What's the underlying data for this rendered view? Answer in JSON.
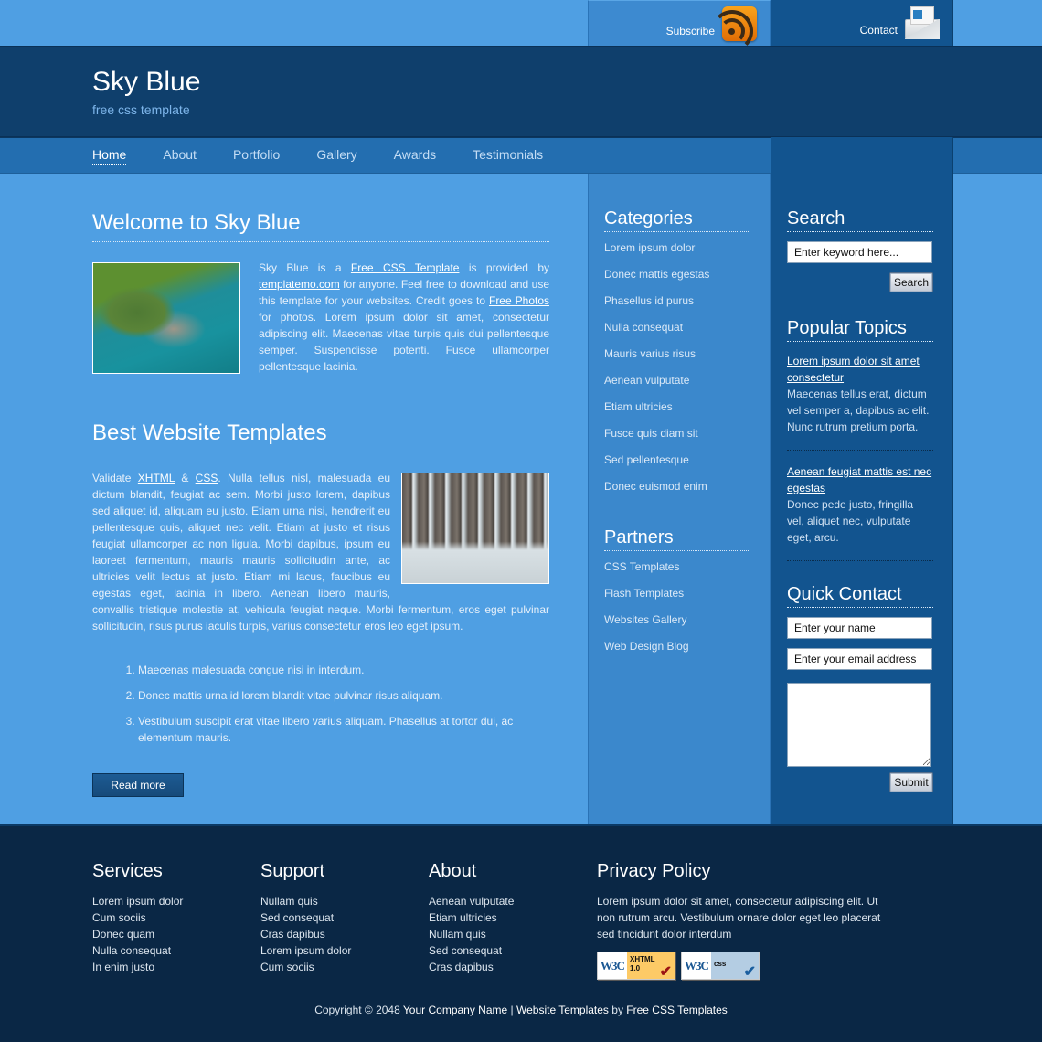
{
  "topbar": {
    "subscribe_label": "Subscribe",
    "contact_label": "Contact"
  },
  "header": {
    "title": "Sky Blue",
    "tagline": "free css template"
  },
  "nav": {
    "items": [
      {
        "label": "Home",
        "active": true
      },
      {
        "label": "About"
      },
      {
        "label": "Portfolio"
      },
      {
        "label": "Gallery"
      },
      {
        "label": "Awards"
      },
      {
        "label": "Testimonials"
      }
    ]
  },
  "main": {
    "welcome": {
      "title": "Welcome to Sky Blue",
      "text_1": "Sky Blue is a ",
      "link_1": "Free CSS Template",
      "text_2": " is provided by ",
      "link_2": "templatemo.com",
      "text_3": " for anyone. Feel free to download and use this template for your websites. Credit goes to ",
      "link_3": "Free Photos",
      "text_4": " for photos. Lorem ipsum dolor sit amet, consectetur adipiscing elit. Maecenas vitae turpis quis dui pellentesque semper. Suspendisse potenti. Fusce ullamcorper pellentesque lacinia."
    },
    "best": {
      "title": "Best Website Templates",
      "text_1": "Validate ",
      "link_xhtml": "XHTML",
      "text_2": " & ",
      "link_css": "CSS",
      "text_3": ". Nulla tellus nisl, malesuada eu dictum blandit, feugiat ac sem. Morbi justo lorem, dapibus sed aliquet id, aliquam eu justo. Etiam urna nisi, hendrerit eu pellentesque quis, aliquet nec velit. Etiam at justo et risus feugiat ullamcorper ac non ligula. Morbi dapibus, ipsum eu laoreet fermentum, mauris mauris sollicitudin ante, ac ultricies velit lectus at justo. Etiam mi lacus, faucibus eu egestas eget, lacinia in libero. Aenean libero mauris, convallis tristique molestie at, vehicula feugiat neque. Morbi fermentum, eros eget pulvinar sollicitudin, risus purus iaculis turpis, varius consectetur eros leo eget ipsum."
    },
    "list": [
      "Maecenas malesuada congue nisi in interdum.",
      "Donec mattis urna id lorem blandit vitae pulvinar risus aliquam.",
      "Vestibulum suscipit erat vitae libero varius aliquam. Phasellus at tortor dui, ac elementum mauris."
    ],
    "read_more_label": "Read more"
  },
  "categories": {
    "title": "Categories",
    "items": [
      "Lorem ipsum dolor",
      "Donec mattis egestas",
      "Phasellus id purus",
      "Nulla consequat",
      "Mauris varius risus",
      "Aenean vulputate",
      "Etiam ultricies",
      "Fusce quis diam sit",
      "Sed pellentesque",
      "Donec euismod enim"
    ]
  },
  "partners": {
    "title": "Partners",
    "items": [
      "CSS Templates",
      "Flash Templates",
      "Websites Gallery",
      "Web Design Blog"
    ]
  },
  "search": {
    "title": "Search",
    "input_value": "Enter keyword here...",
    "button_label": "Search"
  },
  "popular": {
    "title": "Popular Topics",
    "topics": [
      {
        "link": "Lorem ipsum dolor sit amet consectetur",
        "text": "Maecenas tellus erat, dictum vel semper a, dapibus ac elit. Nunc rutrum pretium porta."
      },
      {
        "link": "Aenean feugiat mattis est nec egestas",
        "text": "Donec pede justo, fringilla vel, aliquet nec, vulputate eget, arcu."
      }
    ]
  },
  "quick_contact": {
    "title": "Quick Contact",
    "name_value": "Enter your name",
    "email_value": "Enter your email address",
    "message_value": "",
    "submit_label": "Submit"
  },
  "footer": {
    "services": {
      "title": "Services",
      "items": [
        "Lorem ipsum dolor",
        "Cum sociis",
        "Donec quam",
        "Nulla consequat",
        "In enim justo"
      ]
    },
    "support": {
      "title": "Support",
      "items": [
        "Nullam quis",
        "Sed consequat",
        "Cras dapibus",
        "Lorem ipsum dolor",
        "Cum sociis"
      ]
    },
    "about": {
      "title": "About",
      "items": [
        "Aenean vulputate",
        "Etiam ultricies",
        "Nullam quis",
        "Sed consequat",
        "Cras dapibus"
      ]
    },
    "privacy": {
      "title": "Privacy Policy",
      "text": "Lorem ipsum dolor sit amet, consectetur adipiscing elit. Ut non rutrum arcu. Vestibulum ornare dolor eget leo placerat sed tincidunt dolor interdum",
      "badge_xhtml": {
        "w3c": "W3C",
        "line1": "XHTML",
        "line2": "1.0"
      },
      "badge_css": {
        "w3c": "W3C",
        "line1": "css"
      }
    },
    "copyright": {
      "prefix": "Copyright © 2048 ",
      "company": "Your Company Name",
      "sep": " | ",
      "templates": "Website Templates",
      "by": " by ",
      "free_css": "Free CSS Templates"
    }
  }
}
